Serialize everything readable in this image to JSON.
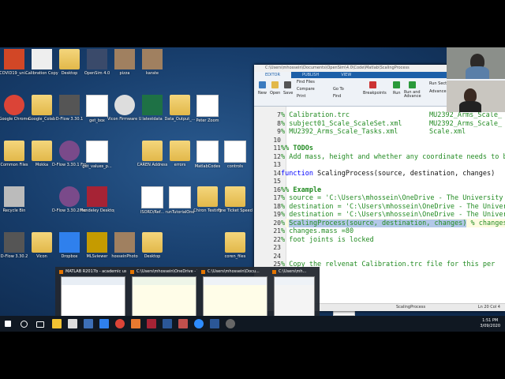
{
  "desktop": {
    "icons": [
      {
        "label": "COVID19_uni...",
        "kind": "ppt"
      },
      {
        "label": "Calibration Copy",
        "kind": "c3d"
      },
      {
        "label": "Desktop",
        "kind": "folder"
      },
      {
        "label": "OpenSim 4.0",
        "kind": "opensim"
      },
      {
        "label": "pizza",
        "kind": "photo"
      },
      {
        "label": "karate",
        "kind": "photo"
      },
      {
        "label": "Google Chrome",
        "kind": "chrome"
      },
      {
        "label": "Google_Colab",
        "kind": "folder"
      },
      {
        "label": "D-Flow 3.30.1",
        "kind": "dflow"
      },
      {
        "label": "get_box",
        "kind": "doc"
      },
      {
        "label": "Vicon Firmware U...",
        "kind": "vicon"
      },
      {
        "label": "latestdata",
        "kind": "excel"
      },
      {
        "label": "Data_Output_...",
        "kind": "folder"
      },
      {
        "label": "Peter Zoom",
        "kind": "doc"
      },
      {
        "label": "Common Files",
        "kind": "folder"
      },
      {
        "label": "Mokka",
        "kind": "folder"
      },
      {
        "label": "D-Flow 3.30.1 Frontend",
        "kind": "dflow2"
      },
      {
        "label": "get_values_p...",
        "kind": "doc"
      },
      {
        "label": "CAREN Address",
        "kind": "folder"
      },
      {
        "label": "errors",
        "kind": "folder"
      },
      {
        "label": "MatlabCodes",
        "kind": "doc"
      },
      {
        "label": "controls",
        "kind": "doc"
      },
      {
        "label": "Recycle Bin",
        "kind": "bin"
      },
      {
        "label": "D-Flow 3.30.2 Frontend",
        "kind": "dflow2"
      },
      {
        "label": "Mendeley Desktop",
        "kind": "mendeley"
      },
      {
        "label": "ISORD/Ref...",
        "kind": "pdf"
      },
      {
        "label": "runTutorialOne",
        "kind": "doc"
      },
      {
        "label": "Chiron Testing",
        "kind": "folder"
      },
      {
        "label": "Fine Ticket Speed",
        "kind": "folder"
      },
      {
        "label": "D-Flow 3.30.2",
        "kind": "dflow"
      },
      {
        "label": "Vicon",
        "kind": "folder"
      },
      {
        "label": "Dropbox",
        "kind": "dropbox"
      },
      {
        "label": "MLSviewer",
        "kind": "mls"
      },
      {
        "label": "hosseinPhoto",
        "kind": "photo"
      },
      {
        "label": "Desktop",
        "kind": "folder"
      },
      {
        "label": "coren_files",
        "kind": "folder"
      },
      {
        "label": "New Text Document (2)",
        "kind": "doc"
      }
    ]
  },
  "matlab": {
    "title": "C:\\Users\\mhossein\\Documents\\OpenSim\\4.0\\Code\\Matlab\\ScalingProcess",
    "tabs": [
      "EDITOR",
      "PUBLISH",
      "VIEW"
    ],
    "ribbon": {
      "new": "New",
      "open": "Open",
      "save": "Save",
      "find_files": "Find Files",
      "compare": "Compare",
      "print": "Print",
      "goto": "Go To",
      "find": "Find",
      "breakpoints": "Breakpoints",
      "run": "Run",
      "run_advance": "Run and Advance",
      "run_section": "Run Section",
      "advance": "Advance"
    },
    "lines": [
      {
        "n": "7",
        "text": "% Calibration.trc",
        "right": "MU2392_Arms_Scale_"
      },
      {
        "n": "8",
        "text": "% subject01_Scale_ScaleSet.xml",
        "right": "MU2392_Arms_Scale_"
      },
      {
        "n": "9",
        "text": "% MU2392_Arms_Scale_Tasks.xml",
        "right": "Scale.xml"
      },
      {
        "n": "10",
        "text": "",
        "right": ""
      },
      {
        "n": "11",
        "text": "%% TODOs",
        "right": ""
      },
      {
        "n": "12",
        "text": "% Add mass, height and whether any coordinate needs to be",
        "right": ""
      },
      {
        "n": "13",
        "text": "",
        "right": ""
      },
      {
        "n": "14",
        "text_kw": "function",
        "text": " ScalingProcess(source, destination, changes)",
        "right": ""
      },
      {
        "n": "15",
        "text": "",
        "right": ""
      },
      {
        "n": "16",
        "text": "%% Example",
        "right": ""
      },
      {
        "n": "17",
        "text": "% source = 'C:\\Users\\mhossein\\OneDrive - The University of",
        "right": ""
      },
      {
        "n": "18",
        "text": "% destination = 'C:\\Users\\mhossein\\OneDrive - The Universi",
        "right": ""
      },
      {
        "n": "19",
        "text": "% destination = 'C:\\Users\\mhossein\\OneDrive - The Universi",
        "right": ""
      },
      {
        "n": "20",
        "text_pre": "% ",
        "text_sel": "ScalingProcess(source, destination, changes)",
        "text_post": " % changes.1",
        "right": ""
      },
      {
        "n": "21",
        "text": "% changes.mass =80",
        "right": ""
      },
      {
        "n": "22",
        "text": "% foot joints is locked",
        "right": ""
      },
      {
        "n": "23",
        "text": "",
        "right": ""
      },
      {
        "n": "24",
        "text": "",
        "right": ""
      },
      {
        "n": "25",
        "text": "% Copy the relvenat Calibration.trc file for this per",
        "right": ""
      }
    ],
    "status": {
      "func": "ScalingProcess",
      "pos": "Ln 20  Col 4"
    }
  },
  "taskbar_popup": {
    "thumbs": [
      "MATLAB R2017b - academic use",
      "C:\\Users\\mhossein\\OneDrive - T...",
      "C:\\Users\\mhossein\\Docu...",
      "C:\\Users\\mh..."
    ]
  },
  "taskbar": {
    "time": "1:51 PM",
    "date": "3/09/2020"
  }
}
